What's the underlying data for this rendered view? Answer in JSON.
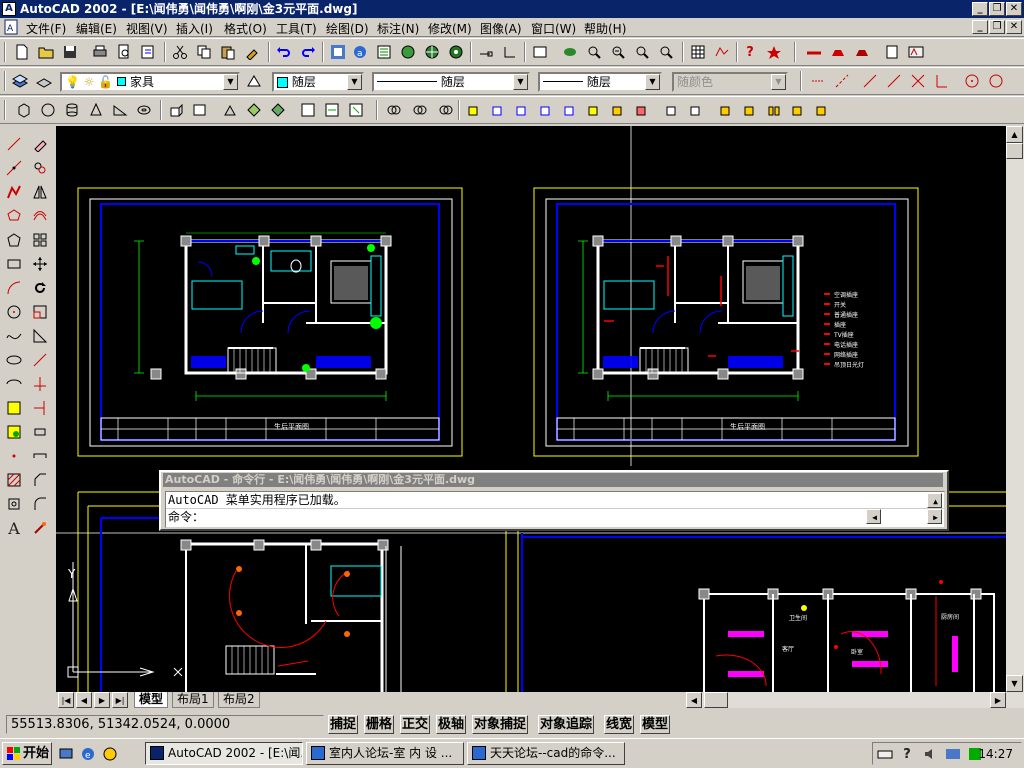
{
  "app": {
    "title": "AutoCAD 2002 - [E:\\闻伟勇\\闻伟勇\\啊刚\\金3元平面.dwg]"
  },
  "window_controls": {
    "minimize": "_",
    "restore": "❐",
    "close": "✕"
  },
  "menubar": {
    "items": [
      "文件(F)",
      "编辑(E)",
      "视图(V)",
      "插入(I)",
      "格式(O)",
      "工具(T)",
      "绘图(D)",
      "标注(N)",
      "修改(M)",
      "图像(A)",
      "窗口(W)",
      "帮助(H)"
    ],
    "doc_controls": {
      "minimize": "_",
      "restore": "❐",
      "close": "✕"
    }
  },
  "properties": {
    "layer": "家具",
    "color": "随层",
    "linetype": "随层",
    "lineweight": "随层",
    "plotstyle": "随颜色"
  },
  "drawing": {
    "plan_title": "生后平面图",
    "legend": [
      "空调插座",
      "开关",
      "普通插座",
      "插座",
      "TV插座",
      "电话插座",
      "网络插座",
      "吊顶日光灯"
    ],
    "room_labels": {
      "kitchen": "厨房间",
      "living": "客厅",
      "bedroom": "卧室",
      "bath": "卫生间"
    },
    "cross_label": "Y"
  },
  "command_window": {
    "title": "AutoCAD - 命令行 - E:\\闻伟勇\\闻伟勇\\啊刚\\金3元平面.dwg",
    "line1": "AutoCAD 菜单实用程序已加载。",
    "prompt": "命令："
  },
  "tabs": {
    "nav": [
      "|◀",
      "◀",
      "▶",
      "▶|"
    ],
    "items": [
      "模型",
      "布局1",
      "布局2"
    ]
  },
  "status": {
    "coords": "55513.8306, 51342.0524, 0.0000",
    "buttons": [
      "捕捉",
      "栅格",
      "正交",
      "极轴",
      "对象捕捉",
      "对象追踪",
      "线宽",
      "模型"
    ]
  },
  "taskbar": {
    "start": "开始",
    "tasks": [
      "AutoCAD 2002 - [E:\\闻...",
      "室内人论坛-室 内 设 ...",
      "天天论坛--cad的命令..."
    ],
    "clock": "14:27"
  },
  "colors": {
    "titlebar": "#0a246a",
    "canvas": "#000000",
    "cad_yellow": "#ffff00",
    "cad_blue": "#0000ff",
    "cad_cyan": "#00ffff",
    "cad_red": "#ff0000",
    "cad_magenta": "#ff00ff"
  }
}
